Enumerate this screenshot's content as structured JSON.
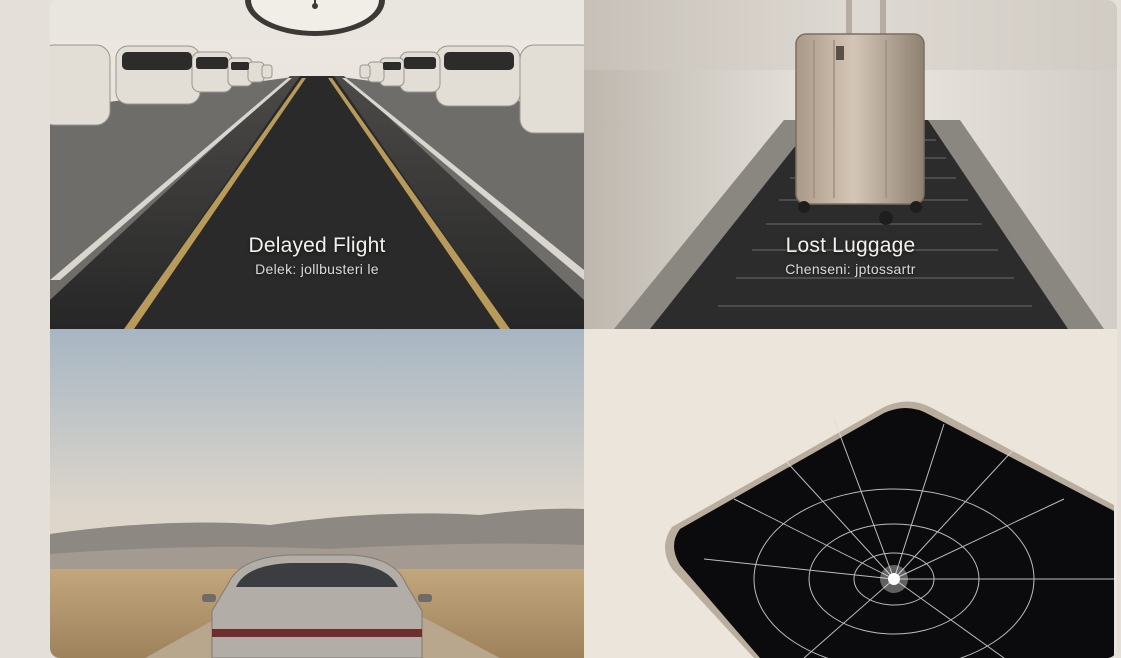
{
  "cards": [
    {
      "title": "Delayed Flight",
      "subtitle": "Delek: jollbusteri le",
      "image": "airport-road-clock-photo"
    },
    {
      "title": "Lost Luggage",
      "subtitle": "Chenseni: jptossartr",
      "image": "suitcase-on-conveyor-photo"
    },
    {
      "title": "",
      "subtitle": "",
      "image": "car-on-desert-road-photo"
    },
    {
      "title": "",
      "subtitle": "",
      "image": "cracked-phone-screen-photo"
    }
  ]
}
